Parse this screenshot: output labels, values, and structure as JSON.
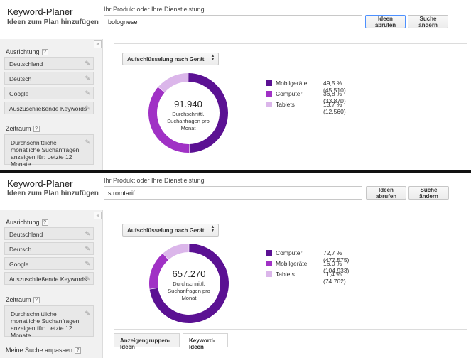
{
  "top": {
    "header": {
      "title": "Keyword-Planer",
      "subtitle": "Ideen zum Plan hinzufügen",
      "product_label": "Ihr Produkt oder Ihre Dienstleistung",
      "search_value": "bolognese",
      "get_ideas_label": "Ideen abrufen",
      "modify_search_label": "Suche ändern"
    },
    "sidebar": {
      "collapse_glyph": "«",
      "targeting_label": "Ausrichtung",
      "items": [
        "Deutschland",
        "Deutsch",
        "Google",
        "Auszuschließende Keywords"
      ],
      "date_range_label": "Zeitraum",
      "date_range_text": "Durchschnittliche monatliche Suchanfragen anzeigen für: Letzte 12 Monate"
    },
    "content": {
      "breakdown_button": "Aufschlüsselung nach Gerät",
      "center_value": "91.940",
      "center_caption": "Durchschnittl. Suchanfragen pro Monat",
      "legend": [
        {
          "label": "Mobilgeräte",
          "stat": "49,5 % (45.510)",
          "color": "#5b1193"
        },
        {
          "label": "Computer",
          "stat": "36,8 % (33.870)",
          "color": "#a031c5"
        },
        {
          "label": "Tablets",
          "stat": "13,7 % (12.560)",
          "color": "#dbb6ea"
        }
      ]
    }
  },
  "bottom": {
    "header": {
      "title": "Keyword-Planer",
      "subtitle": "Ideen zum Plan hinzufügen",
      "product_label": "Ihr Produkt oder Ihre Dienstleistung",
      "search_value": "stromtarif",
      "get_ideas_label": "Ideen abrufen",
      "modify_search_label": "Suche ändern"
    },
    "sidebar": {
      "collapse_glyph": "«",
      "targeting_label": "Ausrichtung",
      "items": [
        "Deutschland",
        "Deutsch",
        "Google",
        "Auszuschließende Keywords"
      ],
      "date_range_label": "Zeitraum",
      "date_range_text": "Durchschnittliche monatliche Suchanfragen anzeigen für: Letzte 12 Monate",
      "customize_label": "Meine Suche anpassen"
    },
    "content": {
      "breakdown_button": "Aufschlüsselung nach Gerät",
      "center_value": "657.270",
      "center_caption": "Durchschnittl. Suchanfragen pro Monat",
      "legend": [
        {
          "label": "Computer",
          "stat": "72,7 % (477.575)",
          "color": "#5b1193"
        },
        {
          "label": "Mobilgeräte",
          "stat": "16,0 % (104.933)",
          "color": "#a031c5"
        },
        {
          "label": "Tablets",
          "stat": "11,4 % (74.762)",
          "color": "#dbb6ea"
        }
      ],
      "tabs": [
        "Anzeigengruppen-Ideen",
        "Keyword-Ideen"
      ]
    }
  },
  "chart_data": [
    {
      "type": "pie",
      "categories": [
        "Mobilgeräte",
        "Computer",
        "Tablets"
      ],
      "values": [
        45510,
        33870,
        12560
      ],
      "percentages": [
        49.5,
        36.8,
        13.7
      ],
      "total": 91940,
      "colors": [
        "#5b1193",
        "#a031c5",
        "#dbb6ea"
      ]
    },
    {
      "type": "pie",
      "categories": [
        "Computer",
        "Mobilgeräte",
        "Tablets"
      ],
      "values": [
        477575,
        104933,
        74762
      ],
      "percentages": [
        72.7,
        16.0,
        11.4
      ],
      "total": 657270,
      "colors": [
        "#5b1193",
        "#a031c5",
        "#dbb6ea"
      ]
    }
  ]
}
